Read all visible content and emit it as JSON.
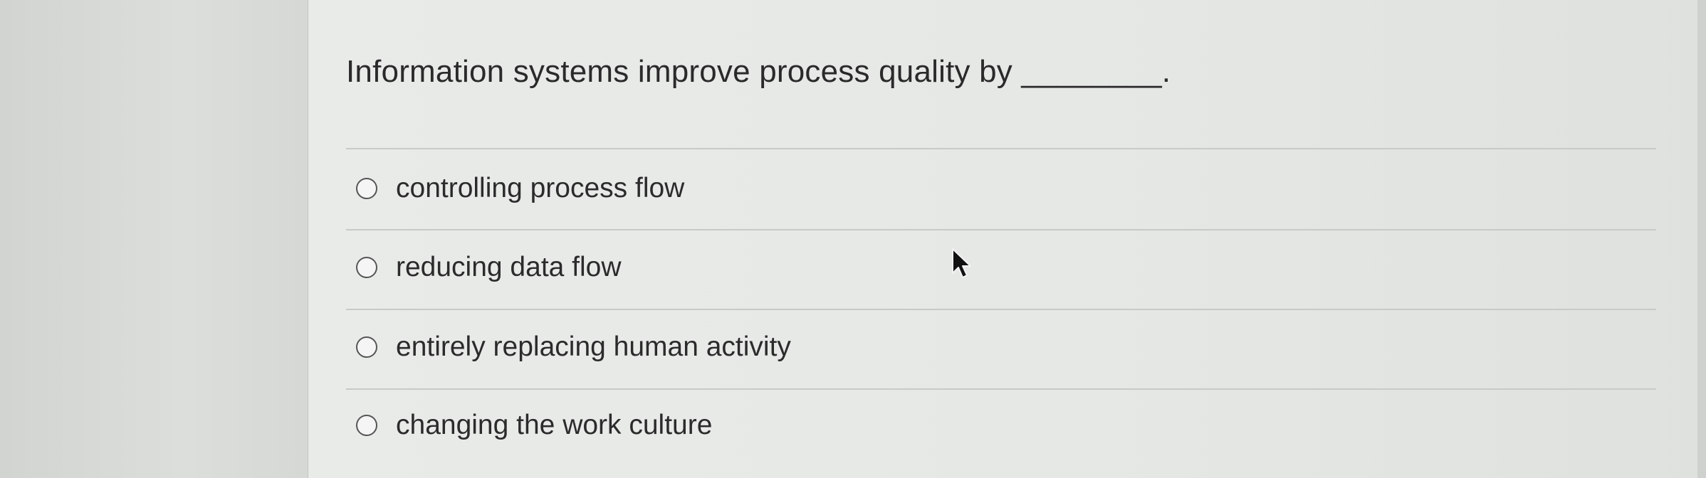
{
  "question": {
    "text": "Information systems improve process quality by ________."
  },
  "options": [
    {
      "label": "controlling process flow",
      "selected": false
    },
    {
      "label": "reducing data flow",
      "selected": false
    },
    {
      "label": "entirely replacing human activity",
      "selected": false
    },
    {
      "label": "changing the work culture",
      "selected": false
    }
  ],
  "cursor": {
    "icon": "mouse-pointer-icon"
  }
}
